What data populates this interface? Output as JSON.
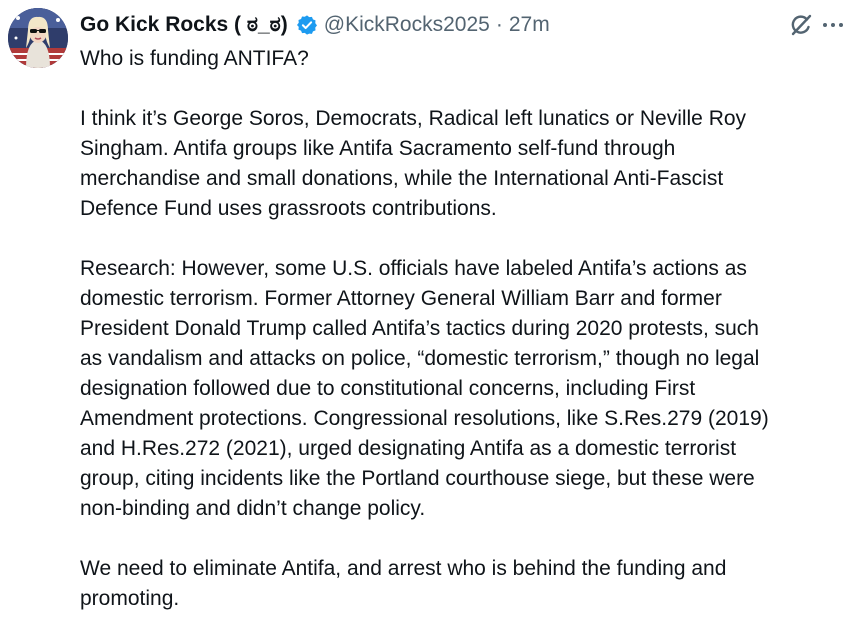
{
  "author": {
    "display_name": "Go Kick Rocks ( ಠ_ಠ)",
    "handle": "@KickRocks2025",
    "separator": "·",
    "time": "27m"
  },
  "icons": {
    "verified": "verified-badge-icon",
    "grok": "grok-icon",
    "more": "more-options-icon"
  },
  "colors": {
    "verified": "#1d9bf0",
    "text": "#0f1419",
    "secondary": "#536471"
  },
  "tweet": {
    "paragraphs": [
      {
        "lines": [
          "Who is funding ANTIFA?"
        ]
      },
      {
        "lines": [
          "I think it’s George Soros, Democrats, Radical left lunatics or Neville Roy",
          "Singham.  Antifa groups like Antifa Sacramento self-fund through",
          "merchandise and small donations, while the International Anti-Fascist",
          "Defence Fund uses grassroots contributions."
        ]
      },
      {
        "lines": [
          "Research:  However, some U.S. officials have labeled Antifa’s actions as",
          "domestic terrorism. Former Attorney General William Barr and former",
          "President Donald Trump called Antifa’s tactics during 2020 protests, such",
          "as vandalism and attacks on police, “domestic terrorism,” though no legal",
          "designation followed due to constitutional concerns, including First",
          "Amendment protections. Congressional resolutions, like S.Res.279 (2019)",
          "and H.Res.272 (2021), urged designating Antifa as a domestic terrorist",
          "group, citing incidents like the Portland courthouse siege, but these were",
          "non-binding and didn’t change policy."
        ]
      },
      {
        "lines": [
          "We need to eliminate Antifa, and arrest who is behind the funding and",
          "promoting."
        ]
      }
    ]
  }
}
